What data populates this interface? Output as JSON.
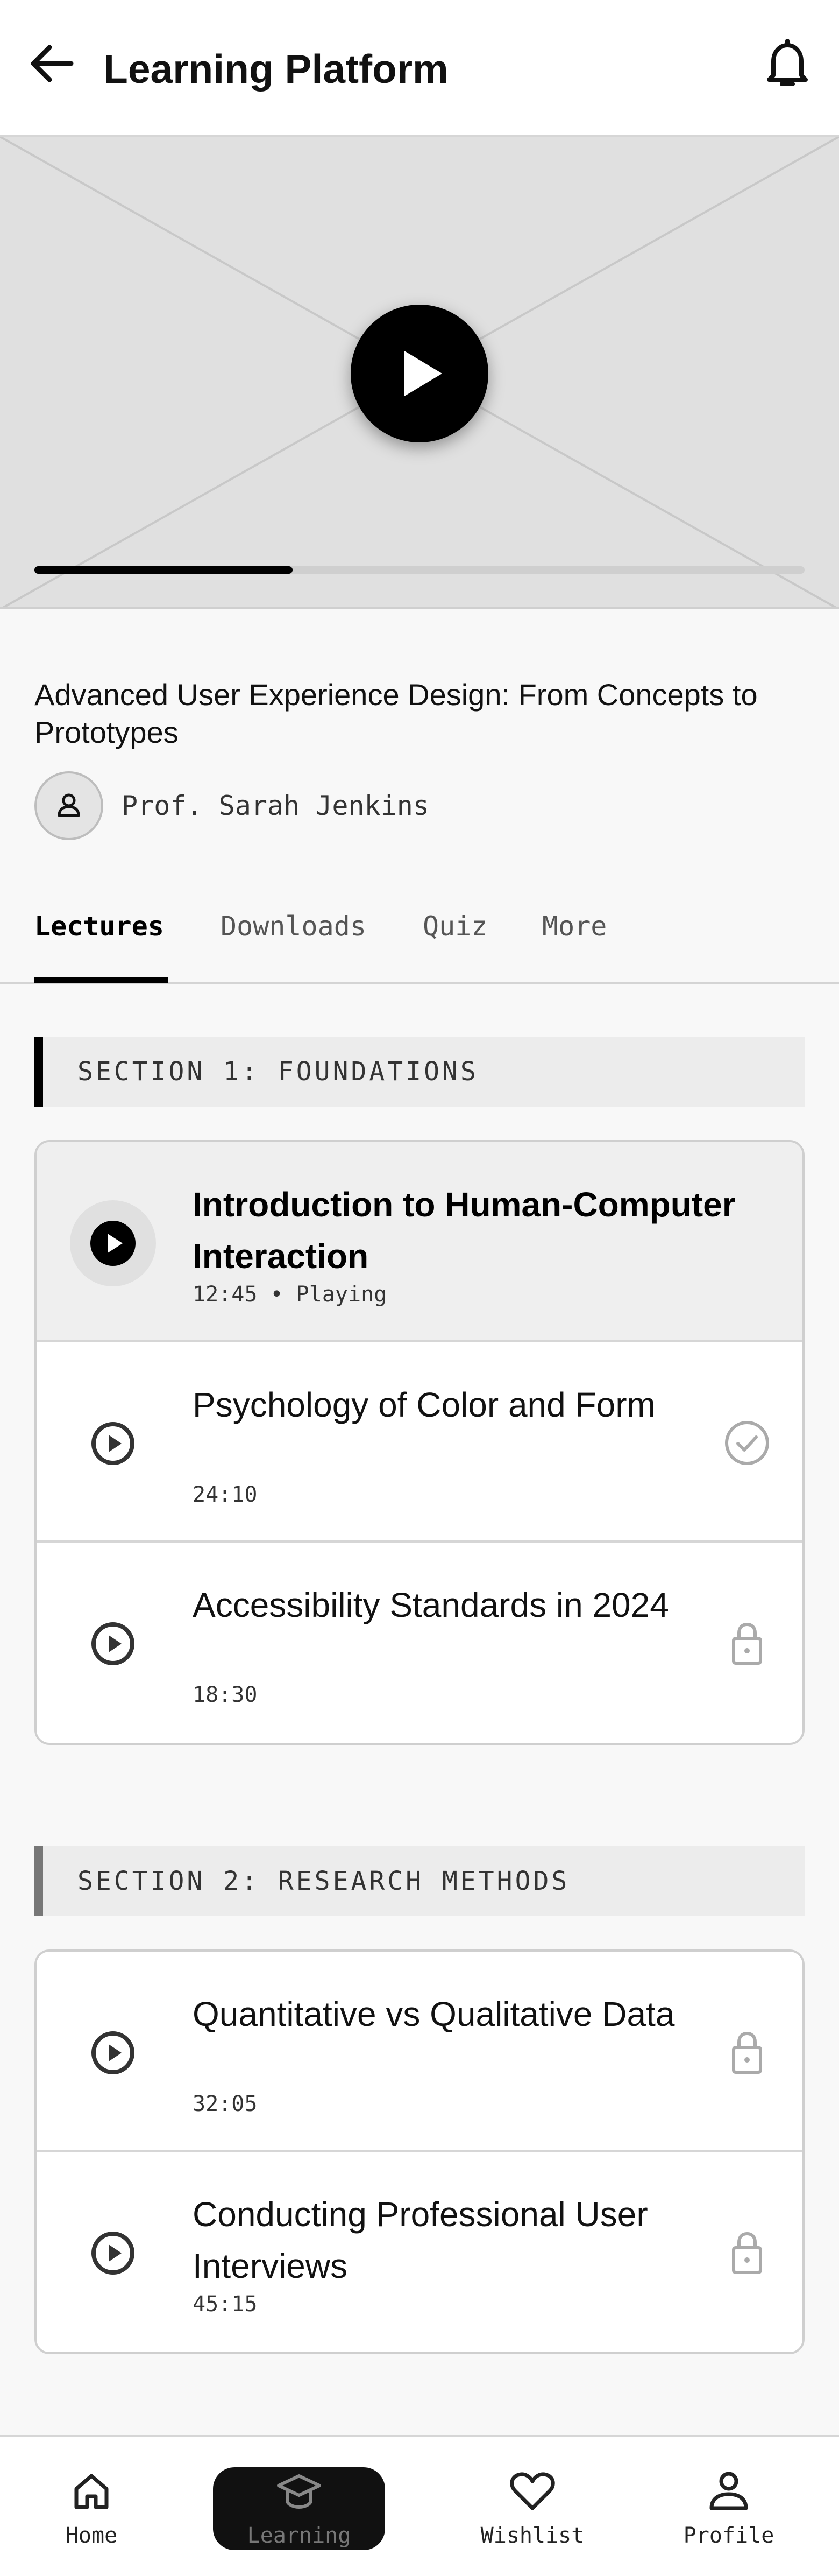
{
  "header": {
    "title": "Learning Platform",
    "back_icon": "arrow-left-icon",
    "notification_icon": "bell-icon"
  },
  "video": {
    "play_icon": "play-icon",
    "progress_fraction": 0.335,
    "placeholder_color": "#e0e0e0",
    "accent": "#000000"
  },
  "course": {
    "title": "Advanced User Experience Design: From Concepts to Prototypes",
    "instructor": "Prof. Sarah Jenkins",
    "instructor_icon": "user-icon"
  },
  "tabs": [
    {
      "label": "Lectures",
      "active": true
    },
    {
      "label": "Downloads",
      "active": false
    },
    {
      "label": "Quiz",
      "active": false
    },
    {
      "label": "More",
      "active": false
    }
  ],
  "sections": [
    {
      "title": "SECTION 1: FOUNDATIONS",
      "accent": "#000000",
      "lectures": [
        {
          "title": "Introduction to Human-Computer Interaction",
          "meta": "12:45 • Playing",
          "state": "playing",
          "status_icon": ""
        },
        {
          "title": "Psychology of Color and Form",
          "meta": "24:10",
          "state": "completed",
          "status_icon": "check-circle-icon"
        },
        {
          "title": "Accessibility Standards in 2024",
          "meta": "18:30",
          "state": "locked",
          "status_icon": "lock-icon"
        }
      ]
    },
    {
      "title": "SECTION 2: RESEARCH METHODS",
      "accent": "#777777",
      "lectures": [
        {
          "title": "Quantitative vs Qualitative Data",
          "meta": "32:05",
          "state": "locked",
          "status_icon": "lock-icon"
        },
        {
          "title": "Conducting Professional User Interviews",
          "meta": "45:15",
          "state": "locked",
          "status_icon": "lock-icon"
        }
      ]
    }
  ],
  "bottom_nav": [
    {
      "label": "Home",
      "icon": "home-icon",
      "active": false
    },
    {
      "label": "Learning",
      "icon": "graduation-cap-icon",
      "active": true
    },
    {
      "label": "Wishlist",
      "icon": "heart-icon",
      "active": false
    },
    {
      "label": "Profile",
      "icon": "profile-icon",
      "active": false
    }
  ]
}
